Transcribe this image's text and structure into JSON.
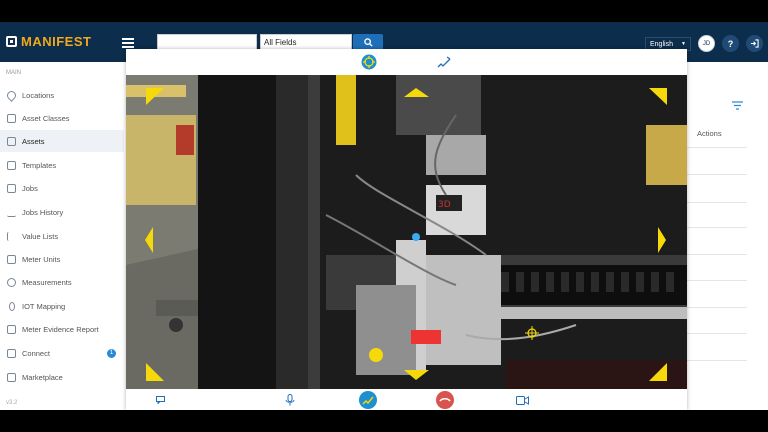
{
  "header": {
    "brand": "MANIFEST",
    "search_value": "",
    "field_select": "All Fields",
    "language": "English",
    "user_initials": "JD",
    "help_label": "?"
  },
  "sidebar": {
    "section": "MAIN",
    "items": [
      {
        "label": "Locations",
        "icon": "location-pin-icon"
      },
      {
        "label": "Asset Classes",
        "icon": "asset-classes-icon"
      },
      {
        "label": "Assets",
        "icon": "assets-icon",
        "active": true
      },
      {
        "label": "Templates",
        "icon": "book-icon"
      },
      {
        "label": "Jobs",
        "icon": "clipboard-icon"
      },
      {
        "label": "Jobs History",
        "icon": "trend-chart-icon"
      },
      {
        "label": "Value Lists",
        "icon": "list-icon"
      },
      {
        "label": "Meter Units",
        "icon": "meter-units-icon"
      },
      {
        "label": "Measurements",
        "icon": "clock-icon"
      },
      {
        "label": "IOT Mapping",
        "icon": "bulb-icon"
      },
      {
        "label": "Meter Evidence Report",
        "icon": "checklist-icon"
      },
      {
        "label": "Connect",
        "icon": "chat-icon",
        "badge": "1"
      },
      {
        "label": "Marketplace",
        "icon": "store-icon"
      }
    ],
    "version": "v3.2"
  },
  "main": {
    "actions_header": "Actions"
  },
  "video_call": {
    "top_tools": [
      "crosshair-icon",
      "draw-pen-icon"
    ],
    "bottom_tools": [
      "chat-icon",
      "microphone-icon",
      "annotate-icon",
      "hang-up-icon",
      "video-camera-icon"
    ],
    "camera_label": "3D"
  },
  "colors": {
    "header_bg": "#0c2d4c",
    "brand_accent": "#f0a91c",
    "primary": "#1e6fb8",
    "arrow_yellow": "#f5d90a",
    "hangup_red": "#d9534f"
  }
}
